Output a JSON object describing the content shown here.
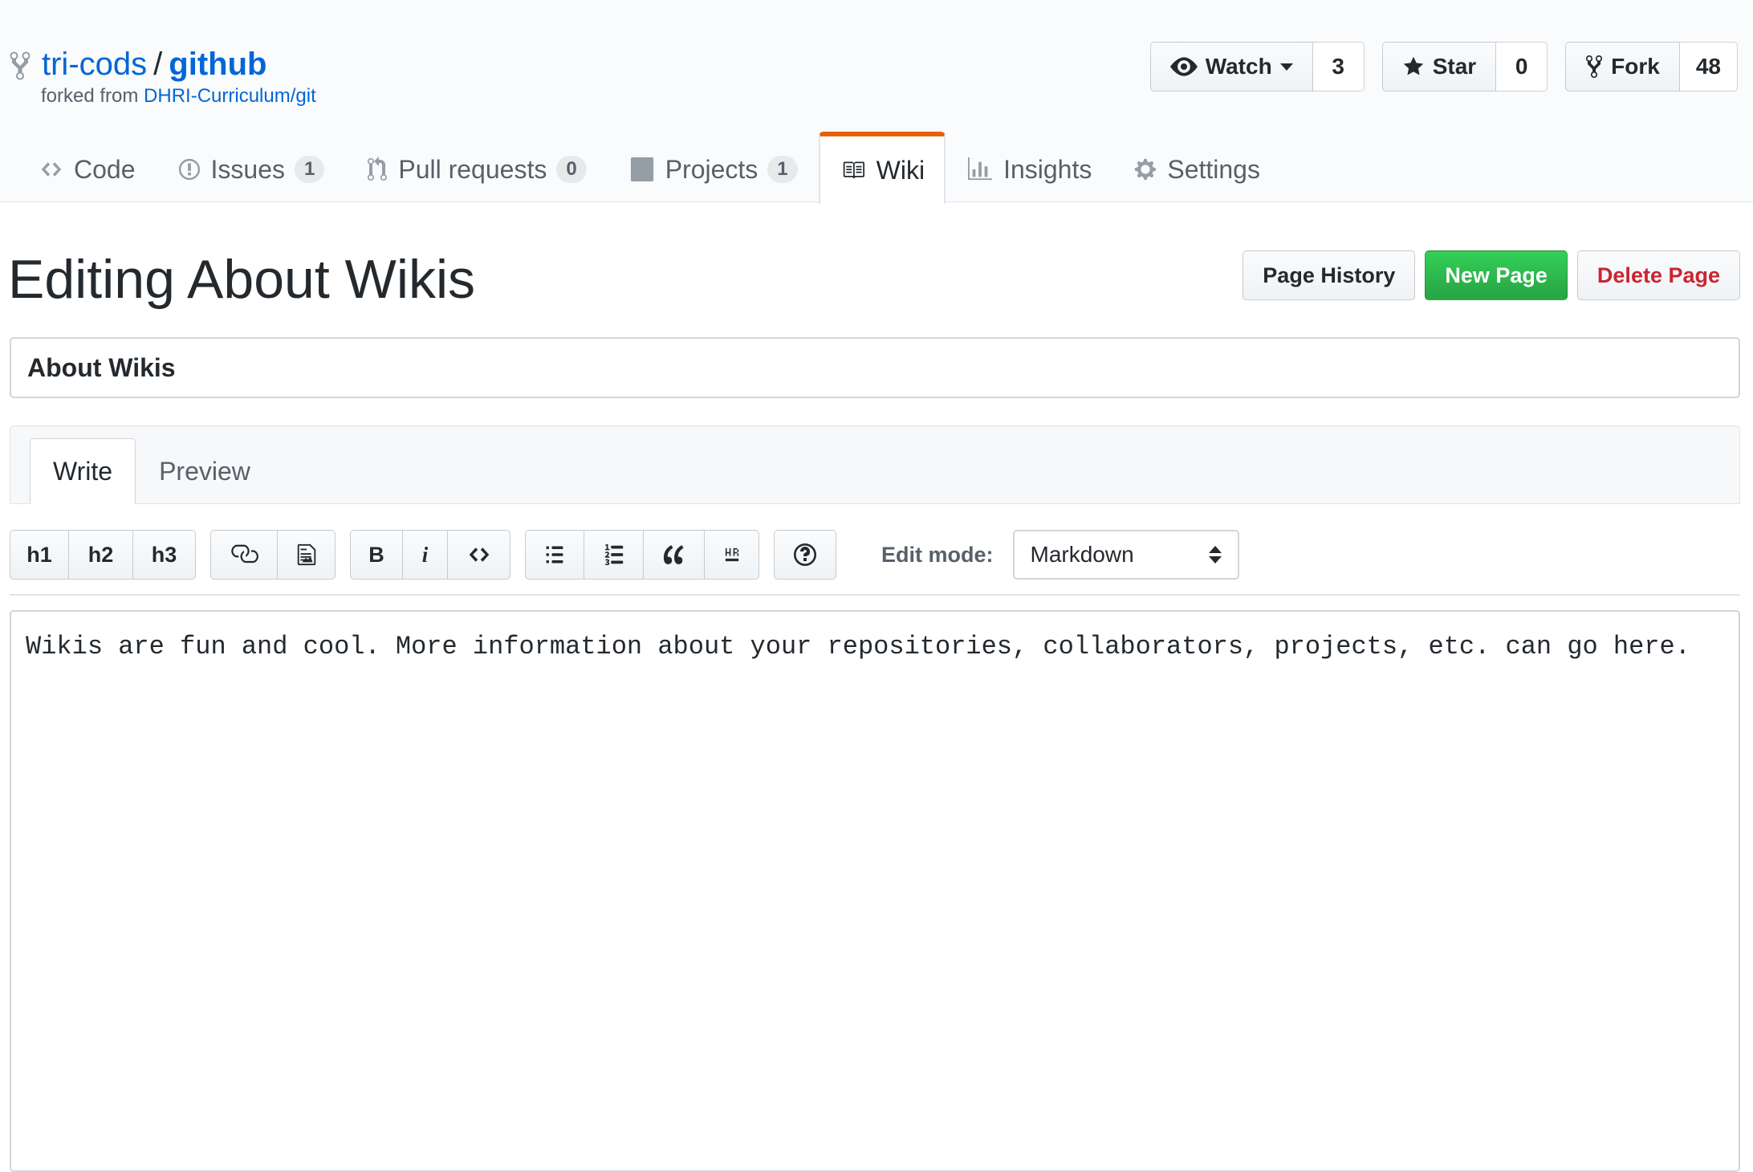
{
  "repo": {
    "owner": "tri-cods",
    "separator": "/",
    "name": "github",
    "forked_from_prefix": "forked from ",
    "forked_from_link": "DHRI-Curriculum/git"
  },
  "actions": {
    "watch": {
      "label": "Watch",
      "count": "3"
    },
    "star": {
      "label": "Star",
      "count": "0"
    },
    "fork": {
      "label": "Fork",
      "count": "48"
    }
  },
  "nav": {
    "code": "Code",
    "issues": "Issues",
    "issues_count": "1",
    "pulls": "Pull requests",
    "pulls_count": "0",
    "projects": "Projects",
    "projects_count": "1",
    "wiki": "Wiki",
    "insights": "Insights",
    "settings": "Settings"
  },
  "page": {
    "title": "Editing About Wikis",
    "history_button": "Page History",
    "new_button": "New Page",
    "delete_button": "Delete Page"
  },
  "form": {
    "title_value": "About Wikis",
    "write_tab": "Write",
    "preview_tab": "Preview",
    "edit_mode_label": "Edit mode:",
    "edit_mode_value": "Markdown",
    "body": "Wikis are fun and cool. More information about your repositories, collaborators, projects, etc. can go here."
  },
  "toolbar": {
    "h1": "h1",
    "h2": "h2",
    "h3": "h3",
    "bold": "B",
    "italic": "i"
  },
  "colors": {
    "link": "#0366d6",
    "selected_tab_accent": "#e36209",
    "primary_button": "#28a745",
    "danger_text": "#cb2431"
  }
}
